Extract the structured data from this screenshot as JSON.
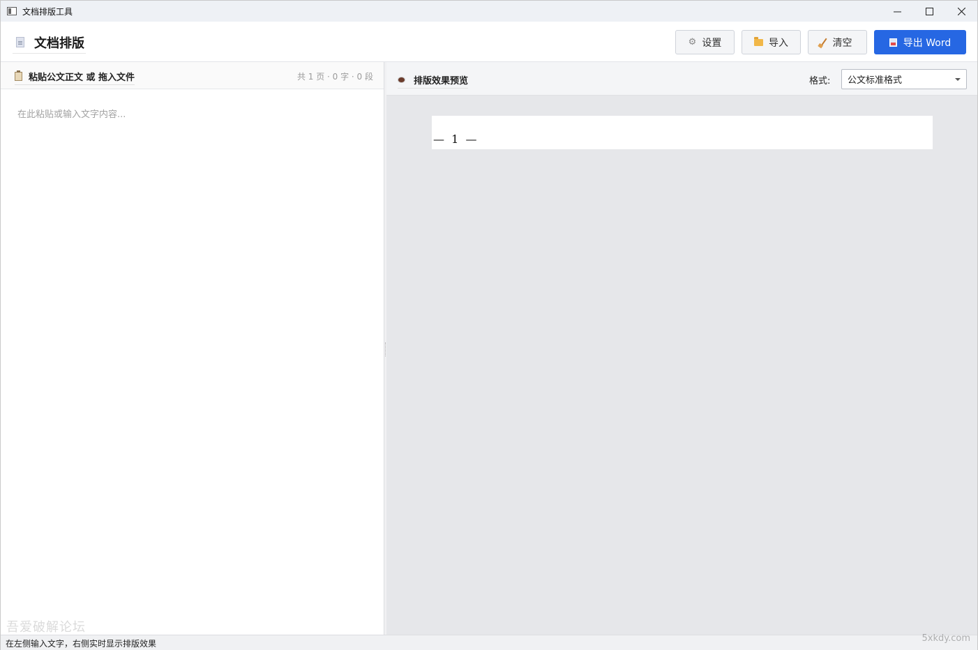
{
  "window": {
    "title": "文档排版工具"
  },
  "header": {
    "title": "文档排版",
    "buttons": {
      "settings": "设置",
      "import": "导入",
      "clear": "清空",
      "export": "导出 Word"
    },
    "accent_color": "#2667e3"
  },
  "left_panel": {
    "title": "粘贴公文正文 或 拖入文件",
    "stats": "共 1 页 · 0 字 · 0 段",
    "editor_placeholder": "在此粘贴或输入文字内容..."
  },
  "right_panel": {
    "title": "排版效果预览",
    "format_label": "格式:",
    "format_value": "公文标准格式",
    "page_number": "—  1  —"
  },
  "status": {
    "text": "在左侧输入文字，右侧实时显示排版效果"
  },
  "watermarks": {
    "left": "吾爱破解论坛",
    "right": "5xkdy.com"
  },
  "icons": [
    "app-icon",
    "document-icon",
    "gear-icon",
    "folder-icon",
    "broom-icon",
    "word-icon",
    "clipboard-icon",
    "eye-icon",
    "minimize-icon",
    "maximize-icon",
    "close-icon",
    "chevron-down-icon"
  ]
}
